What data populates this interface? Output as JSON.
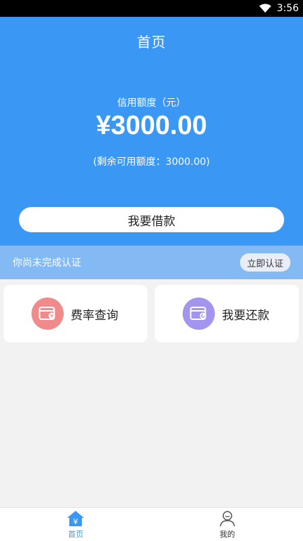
{
  "status_bar": {
    "time": "3:56"
  },
  "header": {
    "title": "首页"
  },
  "credit": {
    "label": "信用额度（元）",
    "amount": "¥3000.00",
    "remaining": "(剩余可用额度：3000.00)"
  },
  "borrow_button": {
    "label": "我要借款"
  },
  "verification": {
    "message": "你尚未完成认证",
    "button_label": "立即认证"
  },
  "cards": [
    {
      "label": "费率查询",
      "icon": "rate-wallet-icon",
      "color": "#f08b8b"
    },
    {
      "label": "我要还款",
      "icon": "repay-wallet-icon",
      "color": "#a394ee"
    }
  ],
  "tabs": [
    {
      "label": "首页",
      "icon": "home-yuan-icon",
      "active": true
    },
    {
      "label": "我的",
      "icon": "user-icon",
      "active": false
    }
  ],
  "colors": {
    "primary": "#3a97f4",
    "verify_bar": "#84baf4"
  }
}
